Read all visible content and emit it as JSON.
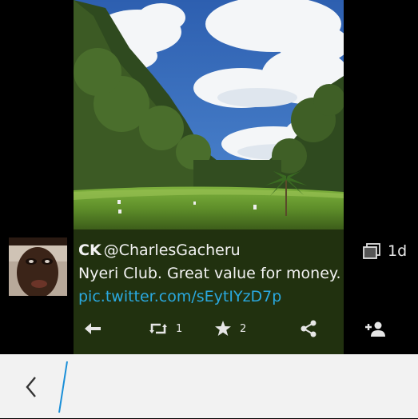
{
  "tweet": {
    "display_name": "CK",
    "handle": "@CharlesGacheru",
    "timestamp": "1d",
    "text": "Nyeri Club. Great value for money.",
    "link": "pic.twitter.com/sEytIYzD7p"
  },
  "actions": {
    "retweet_count": "1",
    "favorite_count": "2"
  },
  "icons": {
    "reply": "reply-arrow-icon",
    "retweet": "retweet-icon",
    "favorite": "star-icon",
    "share": "share-icon",
    "follow": "add-person-icon",
    "media": "gallery-icon",
    "back": "chevron-left-icon"
  },
  "colors": {
    "link": "#2aa9e0",
    "text_cursor": "#1a8fd8",
    "bottom_bar": "#f2f2f2"
  }
}
